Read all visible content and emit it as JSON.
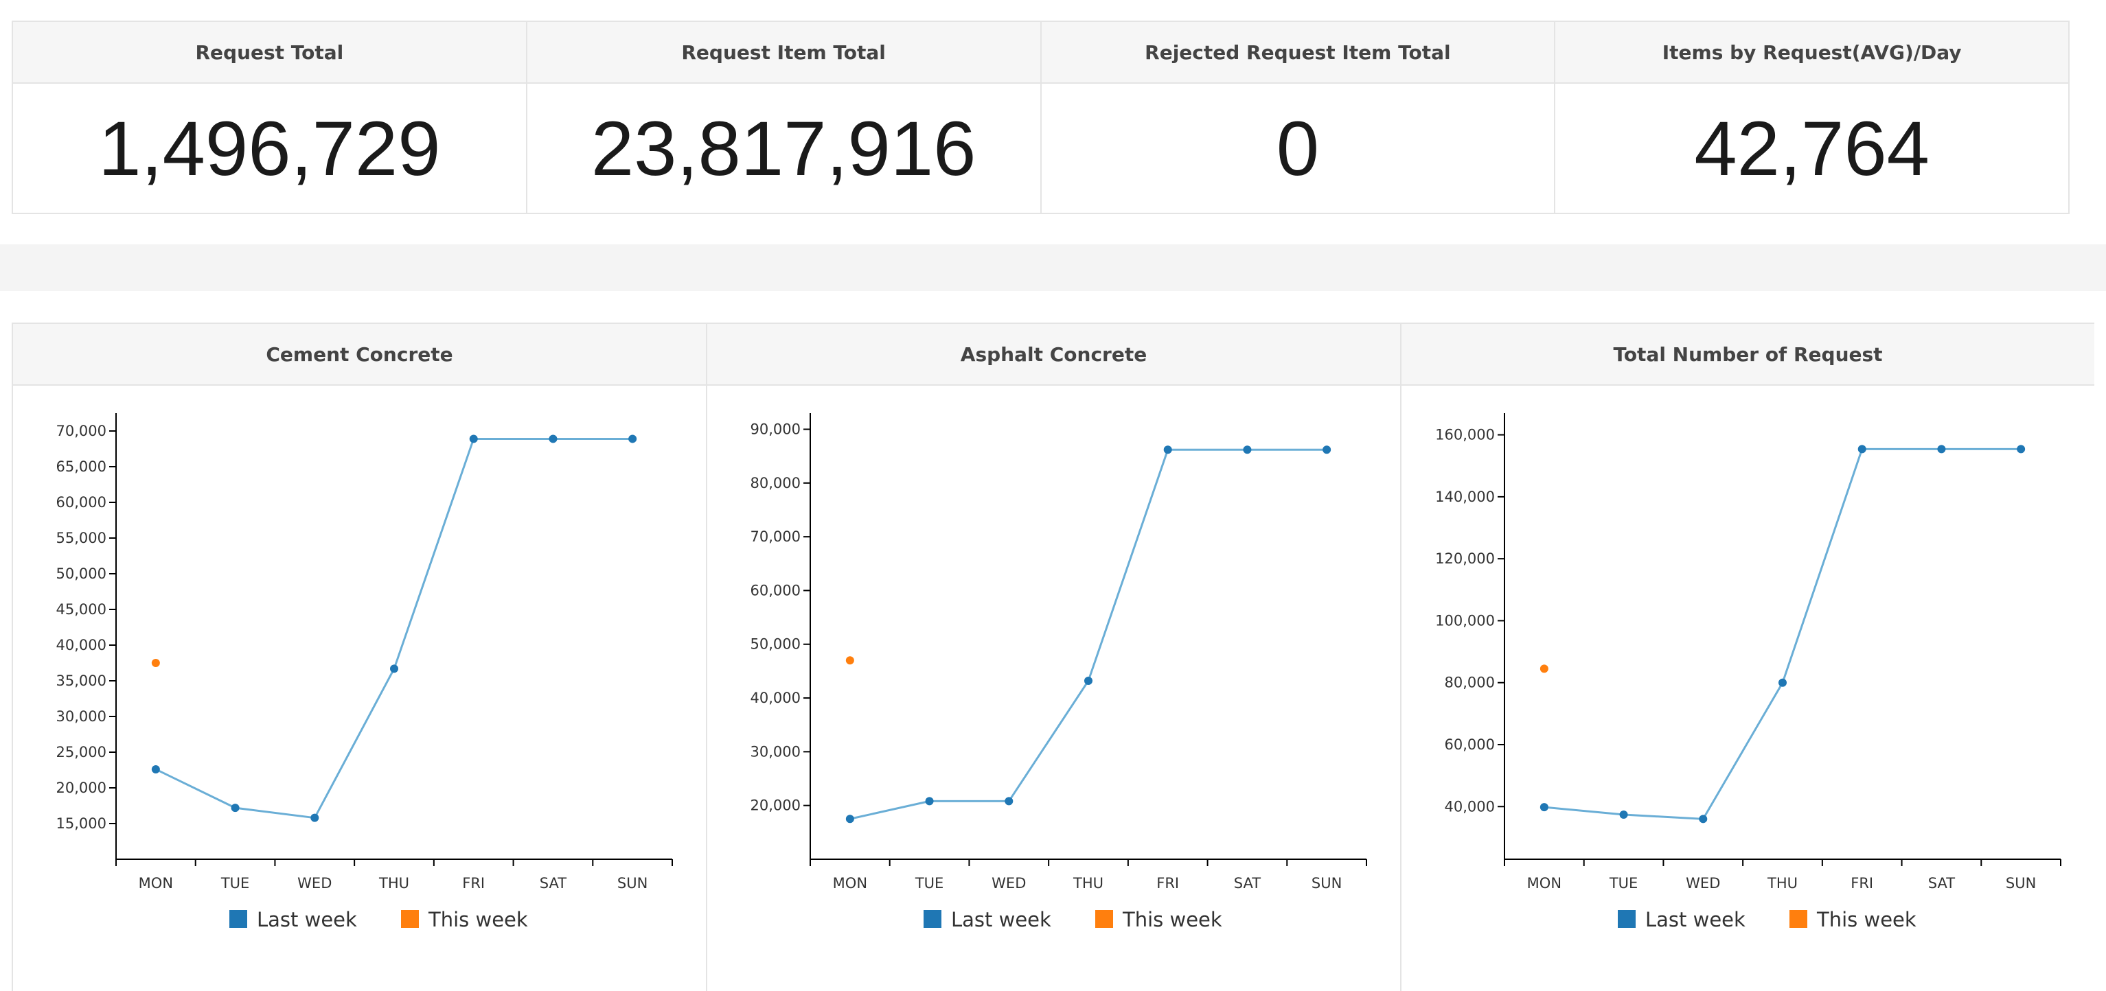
{
  "colors": {
    "last_week": "#1f77b4",
    "last_week_line": "#6aaed6",
    "this_week": "#ff7f0e"
  },
  "stats": [
    {
      "label": "Request Total",
      "value": "1,496,729"
    },
    {
      "label": "Request Item Total",
      "value": "23,817,916"
    },
    {
      "label": "Rejected Request Item Total",
      "value": "0"
    },
    {
      "label": "Items by Request(AVG)/Day",
      "value": "42,764"
    }
  ],
  "chart_data": [
    {
      "type": "line",
      "title": "Cement Concrete",
      "categories": [
        "MON",
        "TUE",
        "WED",
        "THU",
        "FRI",
        "SAT",
        "SUN"
      ],
      "ylim": [
        10000,
        72500
      ],
      "yticks": [
        15000,
        20000,
        25000,
        30000,
        35000,
        40000,
        45000,
        50000,
        55000,
        60000,
        65000,
        70000
      ],
      "grid": false,
      "legend": "bottom",
      "series": [
        {
          "name": "Last week",
          "values": [
            22600,
            17200,
            15800,
            36700,
            68900,
            68900,
            68900
          ]
        },
        {
          "name": "This week",
          "values": [
            37500,
            null,
            null,
            null,
            null,
            null,
            null
          ]
        }
      ]
    },
    {
      "type": "line",
      "title": "Asphalt Concrete",
      "categories": [
        "MON",
        "TUE",
        "WED",
        "THU",
        "FRI",
        "SAT",
        "SUN"
      ],
      "ylim": [
        10000,
        93000
      ],
      "yticks": [
        20000,
        30000,
        40000,
        50000,
        60000,
        70000,
        80000,
        90000
      ],
      "grid": false,
      "legend": "bottom",
      "series": [
        {
          "name": "Last week",
          "values": [
            17500,
            20800,
            20800,
            43200,
            86200,
            86200,
            86200
          ]
        },
        {
          "name": "This week",
          "values": [
            47000,
            null,
            null,
            null,
            null,
            null,
            null
          ]
        }
      ]
    },
    {
      "type": "line",
      "title": "Total Number of Request",
      "categories": [
        "MON",
        "TUE",
        "WED",
        "THU",
        "FRI",
        "SAT",
        "SUN"
      ],
      "ylim": [
        23000,
        167000
      ],
      "yticks": [
        40000,
        60000,
        80000,
        100000,
        120000,
        140000,
        160000
      ],
      "grid": false,
      "legend": "bottom",
      "series": [
        {
          "name": "Last week",
          "values": [
            39800,
            37400,
            36000,
            80000,
            155400,
            155400,
            155400
          ]
        },
        {
          "name": "This week",
          "values": [
            84500,
            null,
            null,
            null,
            null,
            null,
            null
          ]
        }
      ]
    }
  ]
}
